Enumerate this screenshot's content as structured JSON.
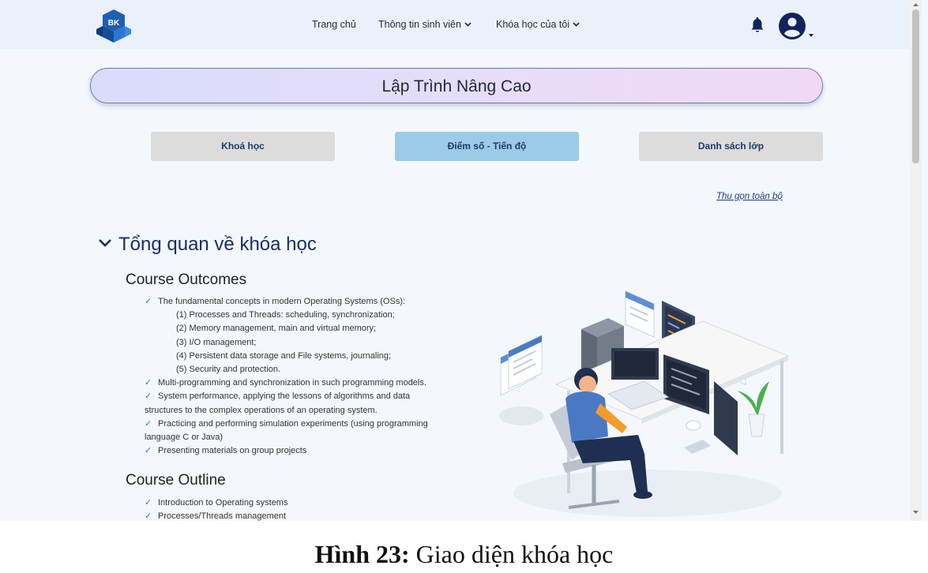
{
  "nav": {
    "logo_text": "BK",
    "links": [
      "Trang chủ",
      "Thông tin sinh viên",
      "Khóa học của tôi"
    ]
  },
  "course": {
    "title": "Lập Trình Nâng Cao",
    "tabs": [
      "Khoá học",
      "Điểm số - Tiến độ",
      "Danh sách lớp"
    ],
    "active_tab": "Điểm số - Tiến độ",
    "collapse_all": "Thu gọn toàn bộ",
    "section_title": "Tổng quan về khóa học",
    "outcomes_title": "Course Outcomes",
    "outcomes": [
      "The fundamental concepts in modern Operating Systems (OSs):",
      "(1) Processes and Threads: scheduling, synchronization;",
      "(2) Memory management, main and virtual memory;",
      "(3) I/O management;",
      "(4) Persistent data storage and File systems, journaling;",
      "(5) Security and protection.",
      "Multi-programming and synchronization in such programming models.",
      "System performance, applying the lessons of algorithms and data structures to the complex operations of an operating system.",
      "Practicing and performing simulation experiments (using programming language C or Java)",
      "Presenting materials on group projects"
    ],
    "outline_title": "Course Outline",
    "outline": [
      "Introduction to Operating systems",
      "Processes/Threads management"
    ]
  },
  "caption": {
    "label": "Hình 23:",
    "text": " Giao diện khóa học"
  },
  "colors": {
    "page_bg": "#f4f8fd",
    "nav_bg": "#eaf1f9",
    "active_tab": "#9ccbe8",
    "tab": "#dcdcdc",
    "heading": "#1b2d66",
    "check": "#3a78c2"
  }
}
